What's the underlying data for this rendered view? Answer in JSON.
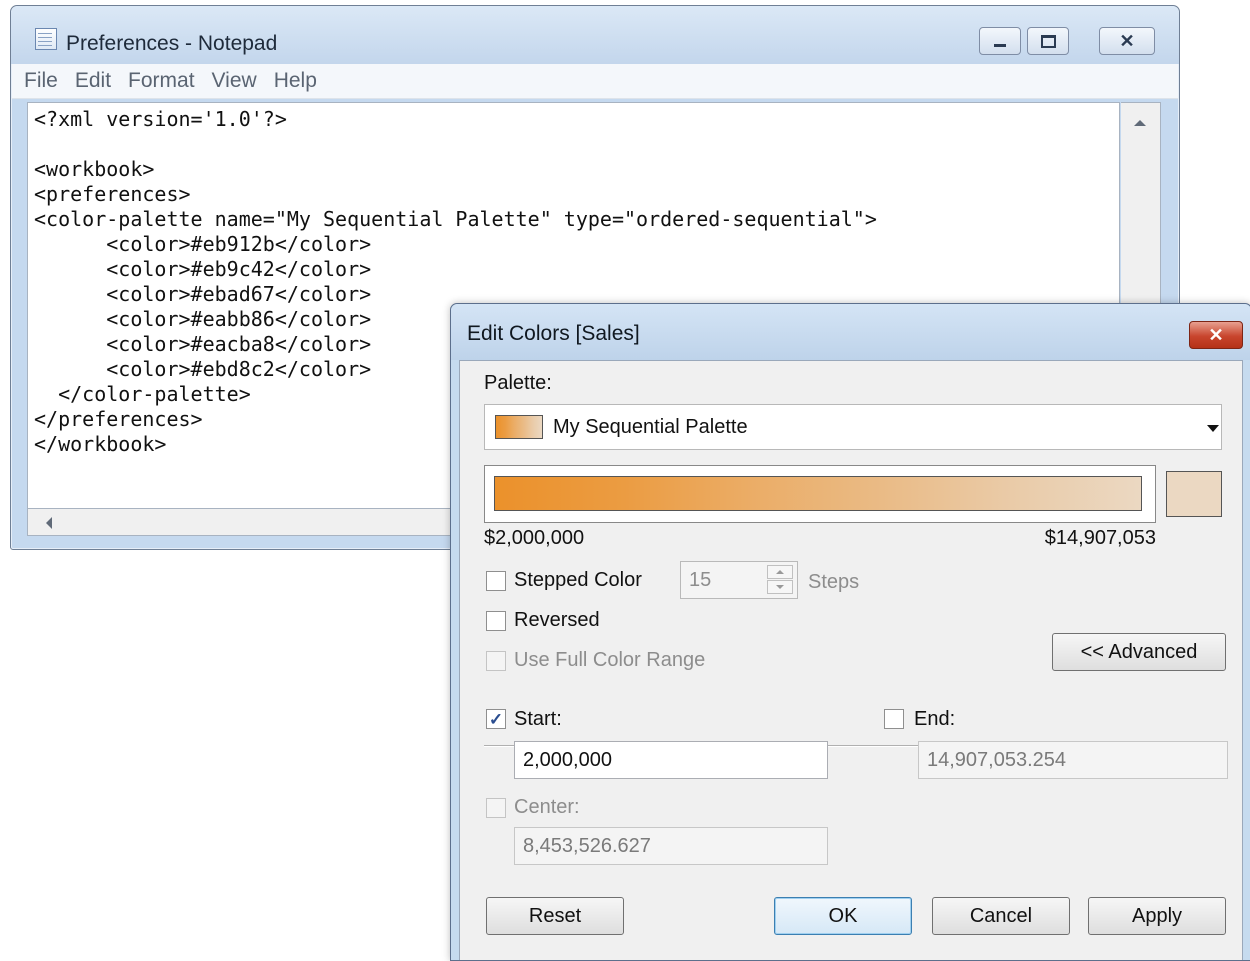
{
  "notepad": {
    "title": "Preferences - Notepad",
    "menu": [
      "File",
      "Edit",
      "Format",
      "View",
      "Help"
    ],
    "lines": [
      "<?xml version='1.0'?>",
      "",
      "<workbook>",
      "<preferences>",
      "<color-palette name=\"My Sequential Palette\" type=\"ordered-sequential\">",
      "      <color>#eb912b</color>",
      "      <color>#eb9c42</color>",
      "      <color>#ebad67</color>",
      "      <color>#eabb86</color>",
      "      <color>#eacba8</color>",
      "      <color>#ebd8c2</color>",
      "  </color-palette>",
      "</preferences>",
      "</workbook>"
    ]
  },
  "dialog": {
    "title": "Edit Colors [Sales]",
    "palette_label": "Palette:",
    "palette_name": "My Sequential Palette",
    "palette_colors": [
      "#eb912b",
      "#eb9c42",
      "#ebad67",
      "#eabb86",
      "#eacba8",
      "#ebd8c2"
    ],
    "end_swatch_color": "#ebd8c2",
    "range_min_label": "$2,000,000",
    "range_max_label": "$14,907,053",
    "stepped_color_label": "Stepped Color",
    "stepped_color_checked": false,
    "steps_value": "15",
    "steps_label": "Steps",
    "reversed_label": "Reversed",
    "reversed_checked": false,
    "full_range_label": "Use Full Color Range",
    "full_range_checked": false,
    "advanced_button": "<< Advanced",
    "start_label": "Start:",
    "start_checked": true,
    "start_value": "2,000,000",
    "end_label": "End:",
    "end_checked": false,
    "end_value": "14,907,053.254",
    "center_label": "Center:",
    "center_checked": false,
    "center_value": "8,453,526.627",
    "buttons": {
      "reset": "Reset",
      "ok": "OK",
      "cancel": "Cancel",
      "apply": "Apply"
    }
  }
}
